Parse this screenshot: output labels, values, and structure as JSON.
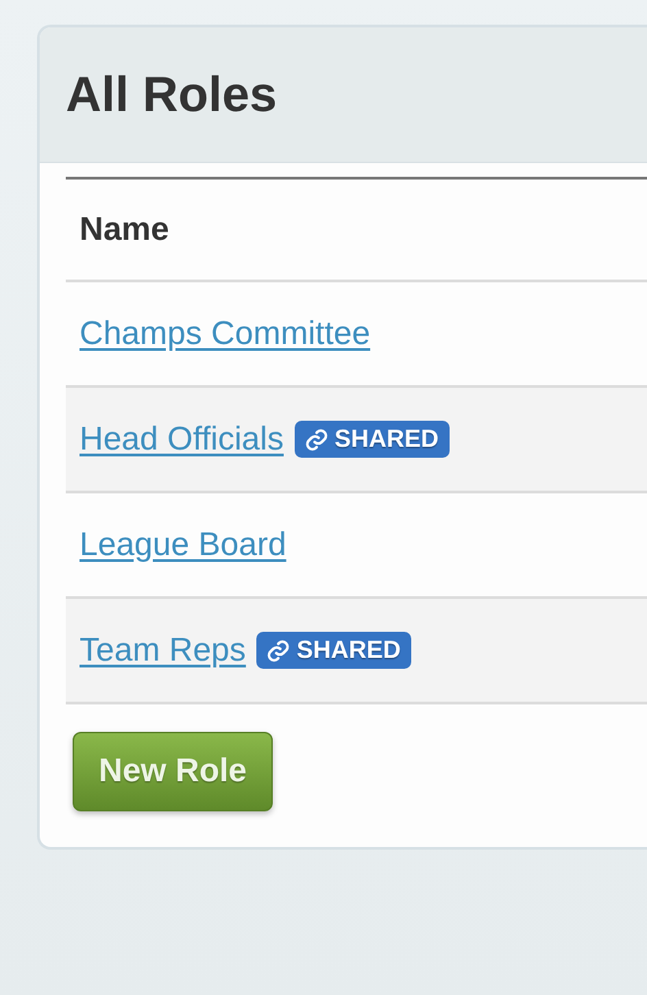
{
  "panel": {
    "title": "All Roles"
  },
  "table": {
    "columns": [
      "Name"
    ],
    "rows": [
      {
        "name": "Champs Committee"
      },
      {
        "name": "Head Officials",
        "badge": "SHARED"
      },
      {
        "name": "League Board"
      },
      {
        "name": "Team Reps",
        "badge": "SHARED"
      }
    ]
  },
  "new_button": "New Role"
}
